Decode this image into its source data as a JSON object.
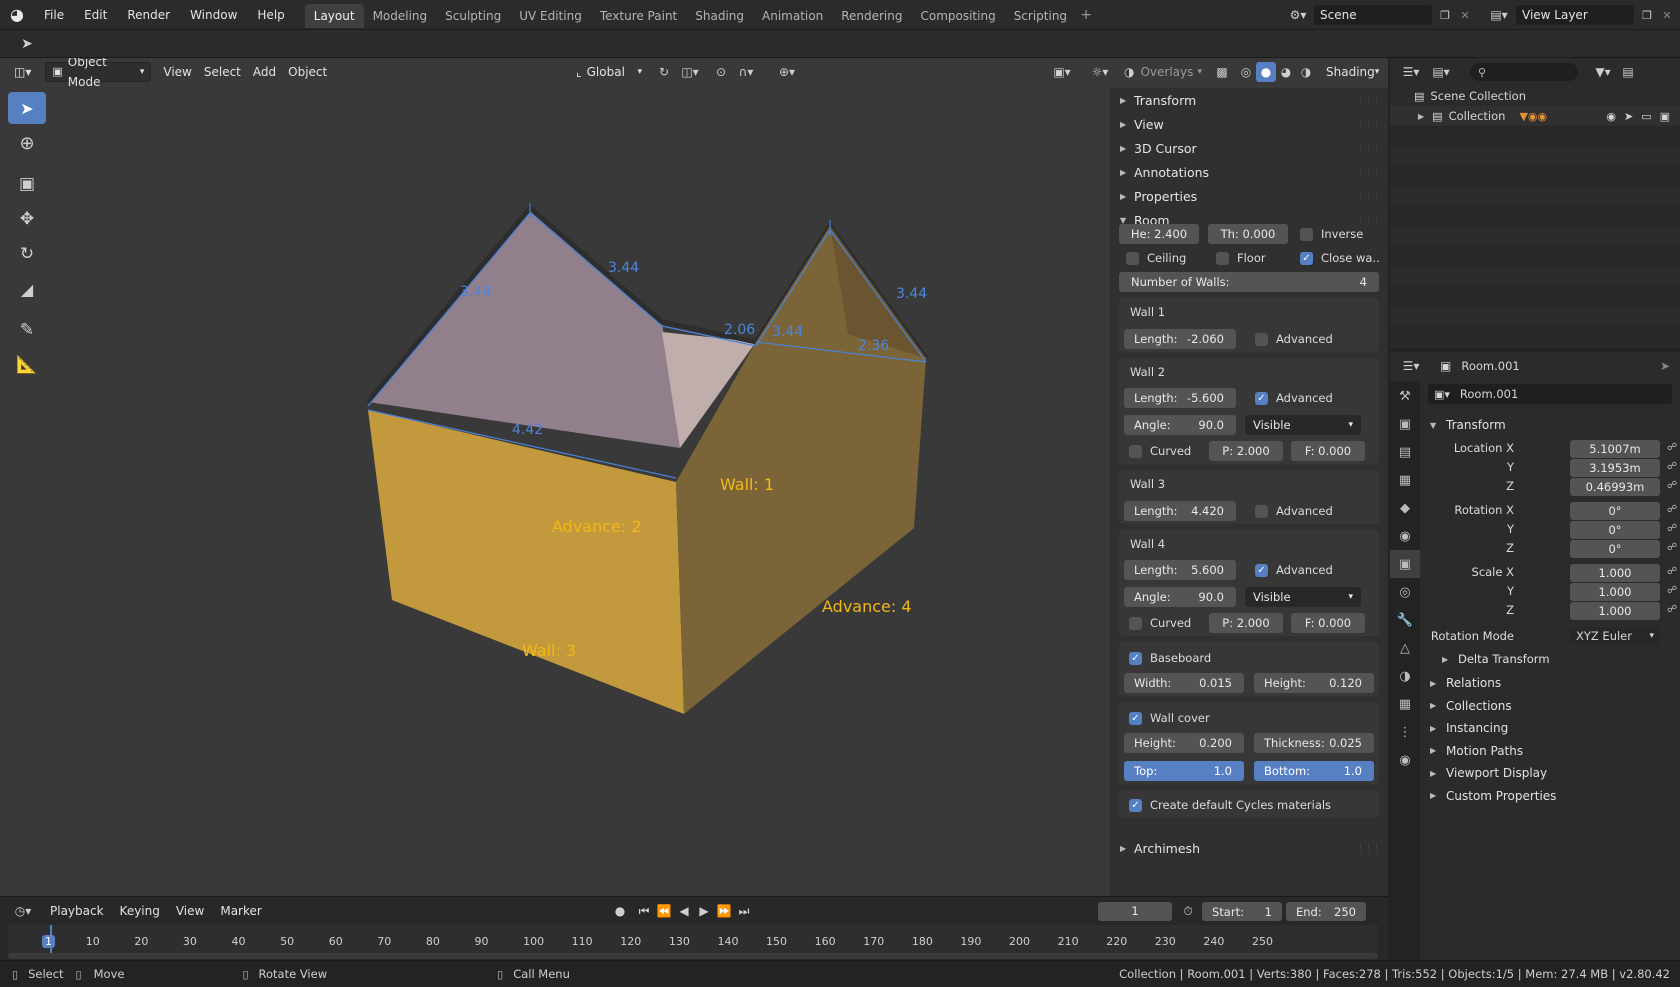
{
  "menus": [
    "File",
    "Edit",
    "Render",
    "Window",
    "Help"
  ],
  "workspaces": [
    "Layout",
    "Modeling",
    "Sculpting",
    "UV Editing",
    "Texture Paint",
    "Shading",
    "Animation",
    "Rendering",
    "Compositing",
    "Scripting"
  ],
  "active_workspace": "Layout",
  "scene": "Scene",
  "view_layer": "View Layer",
  "viewport_header": {
    "mode": "Object Mode",
    "menus": [
      "View",
      "Select",
      "Add",
      "Object"
    ],
    "transform_orientation": "Global",
    "overlays": "Overlays",
    "shading": "Shading"
  },
  "viewport_labels": {
    "dims": [
      "3.44",
      "3.44",
      "2.06",
      "3.44",
      "3.44",
      "2.36",
      "4.42"
    ],
    "walls": [
      "Wall: 1",
      "Advance: 2",
      "Wall: 3",
      "Advance: 4"
    ]
  },
  "npanel": {
    "sections_collapsed": [
      "Transform",
      "View",
      "3D Cursor",
      "Annotations",
      "Properties"
    ],
    "room_title": "Room",
    "height": "He: 2.400",
    "thickness": "Th: 0.000",
    "inverse": "Inverse",
    "ceiling": "Ceiling",
    "floor": "Floor",
    "close_walls": "Close wa..",
    "num_walls_label": "Number of Walls:",
    "num_walls": "4",
    "walls": [
      {
        "title": "Wall 1",
        "length_label": "Length:",
        "length": "-2.060",
        "advanced": "Advanced",
        "advanced_on": false
      },
      {
        "title": "Wall 2",
        "length_label": "Length:",
        "length": "-5.600",
        "advanced": "Advanced",
        "advanced_on": true,
        "angle_label": "Angle:",
        "angle": "90.0",
        "visibility": "Visible",
        "curved": "Curved",
        "p": "P:  2.000",
        "f": "F:  0.000"
      },
      {
        "title": "Wall 3",
        "length_label": "Length:",
        "length": "4.420",
        "advanced": "Advanced",
        "advanced_on": false
      },
      {
        "title": "Wall 4",
        "length_label": "Length:",
        "length": "5.600",
        "advanced": "Advanced",
        "advanced_on": true,
        "angle_label": "Angle:",
        "angle": "90.0",
        "visibility": "Visible",
        "curved": "Curved",
        "p": "P:  2.000",
        "f": "F:  0.000"
      }
    ],
    "baseboard": "Baseboard",
    "bb_width_label": "Width:",
    "bb_width": "0.015",
    "bb_height_label": "Height:",
    "bb_height": "0.120",
    "wallcover": "Wall cover",
    "wc_height_label": "Height:",
    "wc_height": "0.200",
    "wc_thick_label": "Thickness:",
    "wc_thick": "0.025",
    "wc_top_label": "Top:",
    "wc_top": "1.0",
    "wc_bottom_label": "Bottom:",
    "wc_bottom": "1.0",
    "cycles": "Create default Cycles materials",
    "archimesh": "Archimesh"
  },
  "outliner": {
    "scene_collection": "Scene Collection",
    "collection": "Collection"
  },
  "properties": {
    "object_name": "Room.001",
    "datablock": "Room.001",
    "transform": "Transform",
    "location_x_label": "Location X",
    "location_x": "5.1007m",
    "y_label": "Y",
    "location_y": "3.1953m",
    "z_label": "Z",
    "location_z": "0.46993m",
    "rotation_x_label": "Rotation X",
    "rotation_x": "0°",
    "rotation_y": "0°",
    "rotation_z": "0°",
    "scale_x_label": "Scale X",
    "scale_x": "1.000",
    "scale_y": "1.000",
    "scale_z": "1.000",
    "rotation_mode_label": "Rotation Mode",
    "rotation_mode": "XYZ Euler",
    "delta": "Delta Transform",
    "sections": [
      "Relations",
      "Collections",
      "Instancing",
      "Motion Paths",
      "Viewport Display",
      "Custom Properties"
    ]
  },
  "timeline": {
    "menus": [
      "Playback",
      "Keying",
      "View",
      "Marker"
    ],
    "current_frame": "1",
    "start_label": "Start:",
    "start": "1",
    "end_label": "End:",
    "end": "250",
    "ticks": [
      "1",
      "10",
      "20",
      "30",
      "40",
      "50",
      "60",
      "70",
      "80",
      "90",
      "100",
      "110",
      "120",
      "130",
      "140",
      "150",
      "160",
      "170",
      "180",
      "190",
      "200",
      "210",
      "220",
      "230",
      "240",
      "250"
    ]
  },
  "status": {
    "select": "Select",
    "move": "Move",
    "rotate": "Rotate View",
    "call_menu": "Call Menu",
    "info": "Collection | Room.001 | Verts:380 | Faces:278 | Tris:552 | Objects:1/5 | Mem: 27.4 MB | v2.80.42"
  }
}
